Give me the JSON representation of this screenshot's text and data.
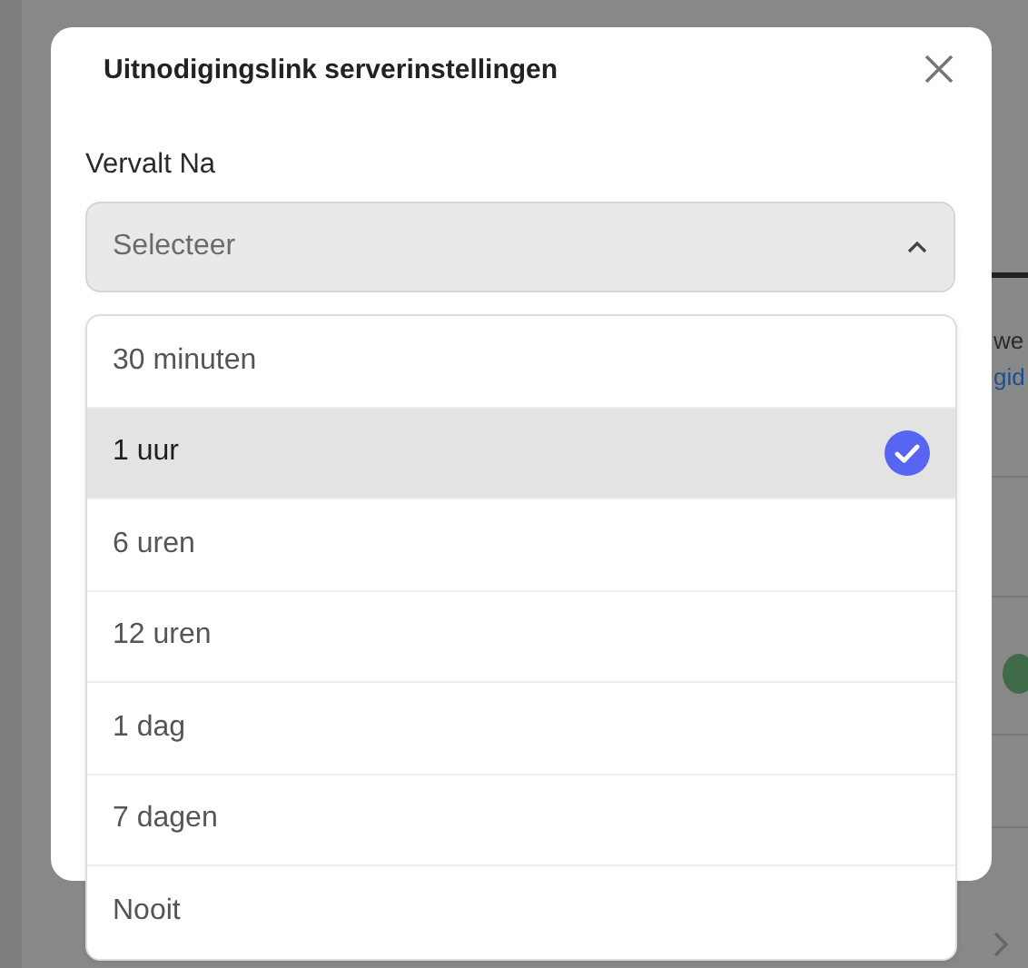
{
  "background": {
    "texts": [
      {
        "text": "we",
        "kind": "plain"
      },
      {
        "text": "gid",
        "kind": "link"
      }
    ]
  },
  "dialog": {
    "title": "Uitnodigingslink serverinstellingen",
    "field": {
      "label": "Vervalt Na",
      "placeholder": "Selecteer",
      "expanded": true
    },
    "options": [
      {
        "label": "30 minuten",
        "selected": false
      },
      {
        "label": "1 uur",
        "selected": true
      },
      {
        "label": "6 uren",
        "selected": false
      },
      {
        "label": "12 uren",
        "selected": false
      },
      {
        "label": "1 dag",
        "selected": false
      },
      {
        "label": "7 dagen",
        "selected": false
      },
      {
        "label": "Nooit",
        "selected": false
      }
    ]
  }
}
